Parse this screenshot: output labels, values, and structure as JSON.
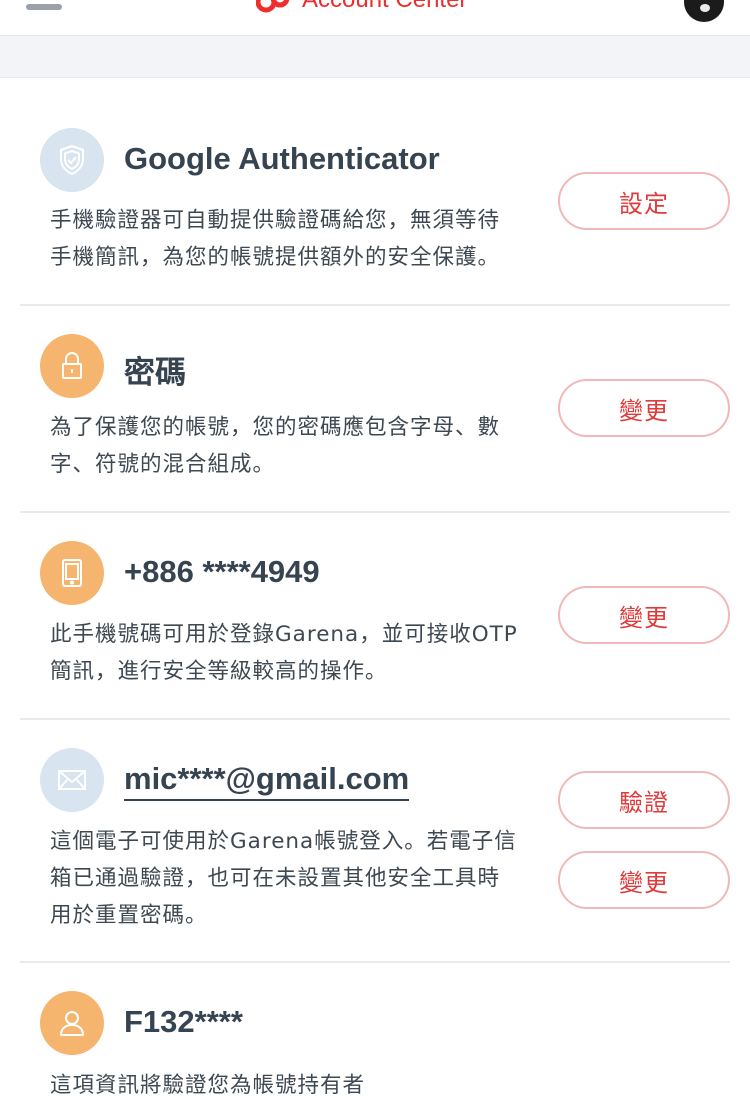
{
  "header": {
    "title": "Account Center",
    "menu_icon": "hamburger-menu-icon",
    "logo_icon": "garena-logo-icon",
    "avatar_icon": "user-avatar-icon",
    "brand_color": "#ee2d2d"
  },
  "items": [
    {
      "icon": "shield-icon",
      "title": "Google Authenticator",
      "description_lines": [
        "手機驗證器可自動提供驗證碼給您，無須等待",
        "手機簡訊，為您的帳號提供額外的安全保護。"
      ],
      "buttons": [
        "設定"
      ]
    },
    {
      "icon": "lock-icon",
      "title": "密碼",
      "description_lines": [
        "為了保護您的帳號，您的密碼應包含字母、數",
        "字、符號的混合組成。"
      ],
      "buttons": [
        "變更"
      ]
    },
    {
      "icon": "phone-icon",
      "title": "+886 ****4949",
      "description_lines": [
        "此手機號碼可用於登錄Garena，並可接收OTP",
        "簡訊，進行安全等級較高的操作。"
      ],
      "buttons": [
        "變更"
      ]
    },
    {
      "icon": "envelope-icon",
      "title": "mic****@gmail.com",
      "description_lines": [
        "這個電子可使用於Garena帳號登入。若電子信",
        "箱已通過驗證，也可在未設置其他安全工具時",
        "用於重置密碼。"
      ],
      "buttons": [
        "驗證",
        "變更"
      ]
    },
    {
      "icon": "id-user-icon",
      "title": "F132****",
      "description_lines": [
        "這項資訊將驗證您為帳號持有者"
      ],
      "buttons": []
    }
  ],
  "colors": {
    "accent_red": "#e13a3a",
    "button_border": "#f1b8b8",
    "icon_blue_bg": "#d8e4ef",
    "icon_orange_bg": "#f6b56f",
    "title_text": "#364350"
  }
}
